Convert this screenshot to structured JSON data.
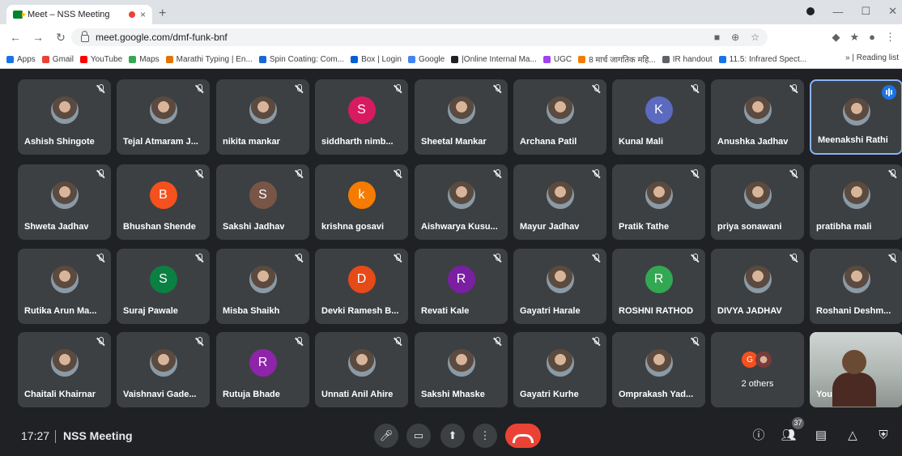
{
  "browser": {
    "tab_title": "Meet – NSS Meeting",
    "close_glyph": "×",
    "new_tab_glyph": "+",
    "url": "meet.google.com/dmf-funk-bnf",
    "bookmarks": [
      {
        "label": "Apps",
        "color": "#1a73e8"
      },
      {
        "label": "Gmail",
        "color": "#ea4335"
      },
      {
        "label": "YouTube",
        "color": "#ff0000"
      },
      {
        "label": "Maps",
        "color": "#34a853"
      },
      {
        "label": "Marathi Typing | En...",
        "color": "#e37400"
      },
      {
        "label": "Spin Coating: Com...",
        "color": "#1967d2"
      },
      {
        "label": "Box | Login",
        "color": "#0061d5"
      },
      {
        "label": "Google",
        "color": "#4285f4"
      },
      {
        "label": "|Online Internal Ma...",
        "color": "#202124"
      },
      {
        "label": "UGC",
        "color": "#a142f4"
      },
      {
        "label": "8 मार्च जागतिक महि...",
        "color": "#f57c00"
      },
      {
        "label": "IR handout",
        "color": "#5f6368"
      },
      {
        "label": "11.5: Infrared Spect...",
        "color": "#1a73e8"
      }
    ],
    "bookmarks_overflow": "»",
    "reading_list": "Reading list"
  },
  "participants": [
    {
      "name": "Ashish Shingote",
      "avatar": "photo"
    },
    {
      "name": "Tejal Atmaram J...",
      "avatar": "photo"
    },
    {
      "name": "nikita mankar",
      "avatar": "photo"
    },
    {
      "name": "siddharth nimb...",
      "avatar": "letter",
      "letter": "S",
      "color": "#d81b60"
    },
    {
      "name": "Sheetal Mankar",
      "avatar": "photo"
    },
    {
      "name": "Archana Patil",
      "avatar": "photo"
    },
    {
      "name": "Kunal Mali",
      "avatar": "letter",
      "letter": "K",
      "color": "#5c6bc0"
    },
    {
      "name": "Anushka Jadhav",
      "avatar": "photo"
    },
    {
      "name": "Meenakshi Rathi",
      "avatar": "photo",
      "speaking": true
    },
    {
      "name": "Shweta Jadhav",
      "avatar": "photo"
    },
    {
      "name": "Bhushan Shende",
      "avatar": "letter",
      "letter": "B",
      "color": "#f4511e"
    },
    {
      "name": "Sakshi Jadhav",
      "avatar": "letter",
      "letter": "S",
      "color": "#795548"
    },
    {
      "name": "krishna gosavi",
      "avatar": "letter",
      "letter": "k",
      "color": "#f57c00"
    },
    {
      "name": "Aishwarya Kusu...",
      "avatar": "photo"
    },
    {
      "name": "Mayur Jadhav",
      "avatar": "photo"
    },
    {
      "name": "Pratik Tathe",
      "avatar": "photo"
    },
    {
      "name": "priya sonawani",
      "avatar": "photo"
    },
    {
      "name": "pratibha mali",
      "avatar": "photo"
    },
    {
      "name": "Rutika Arun Ma...",
      "avatar": "photo"
    },
    {
      "name": "Suraj Pawale",
      "avatar": "letter",
      "letter": "S",
      "color": "#0b8043"
    },
    {
      "name": "Misba Shaikh",
      "avatar": "photo"
    },
    {
      "name": "Devki Ramesh B...",
      "avatar": "letter",
      "letter": "D",
      "color": "#e64a19"
    },
    {
      "name": "Revati Kale",
      "avatar": "letter",
      "letter": "R",
      "color": "#7b1fa2"
    },
    {
      "name": "Gayatri Harale",
      "avatar": "photo"
    },
    {
      "name": "ROSHNI RATHOD",
      "avatar": "letter",
      "letter": "R",
      "color": "#33a853"
    },
    {
      "name": "DIVYA JADHAV",
      "avatar": "photo"
    },
    {
      "name": "Roshani Deshm...",
      "avatar": "photo"
    },
    {
      "name": "Chaitali Khairnar",
      "avatar": "photo"
    },
    {
      "name": "Vaishnavi Gade...",
      "avatar": "photo"
    },
    {
      "name": "Rutuja Bhade",
      "avatar": "letter",
      "letter": "R",
      "color": "#8e24aa"
    },
    {
      "name": "Unnati Anil Ahire",
      "avatar": "photo"
    },
    {
      "name": "Sakshi Mhaske",
      "avatar": "photo"
    },
    {
      "name": "Gayatri Kurhe",
      "avatar": "photo"
    },
    {
      "name": "Omprakash Yad...",
      "avatar": "photo"
    }
  ],
  "others_tile": {
    "label": "2 others",
    "letter": "G"
  },
  "self_tile": {
    "label": "You"
  },
  "bottom_bar": {
    "time": "17:27",
    "meeting_title": "NSS Meeting",
    "people_count": "37"
  },
  "colors": {
    "leave": "#ea4335",
    "accent": "#8ab4f8",
    "background": "#202124",
    "tile": "#3c4043"
  }
}
